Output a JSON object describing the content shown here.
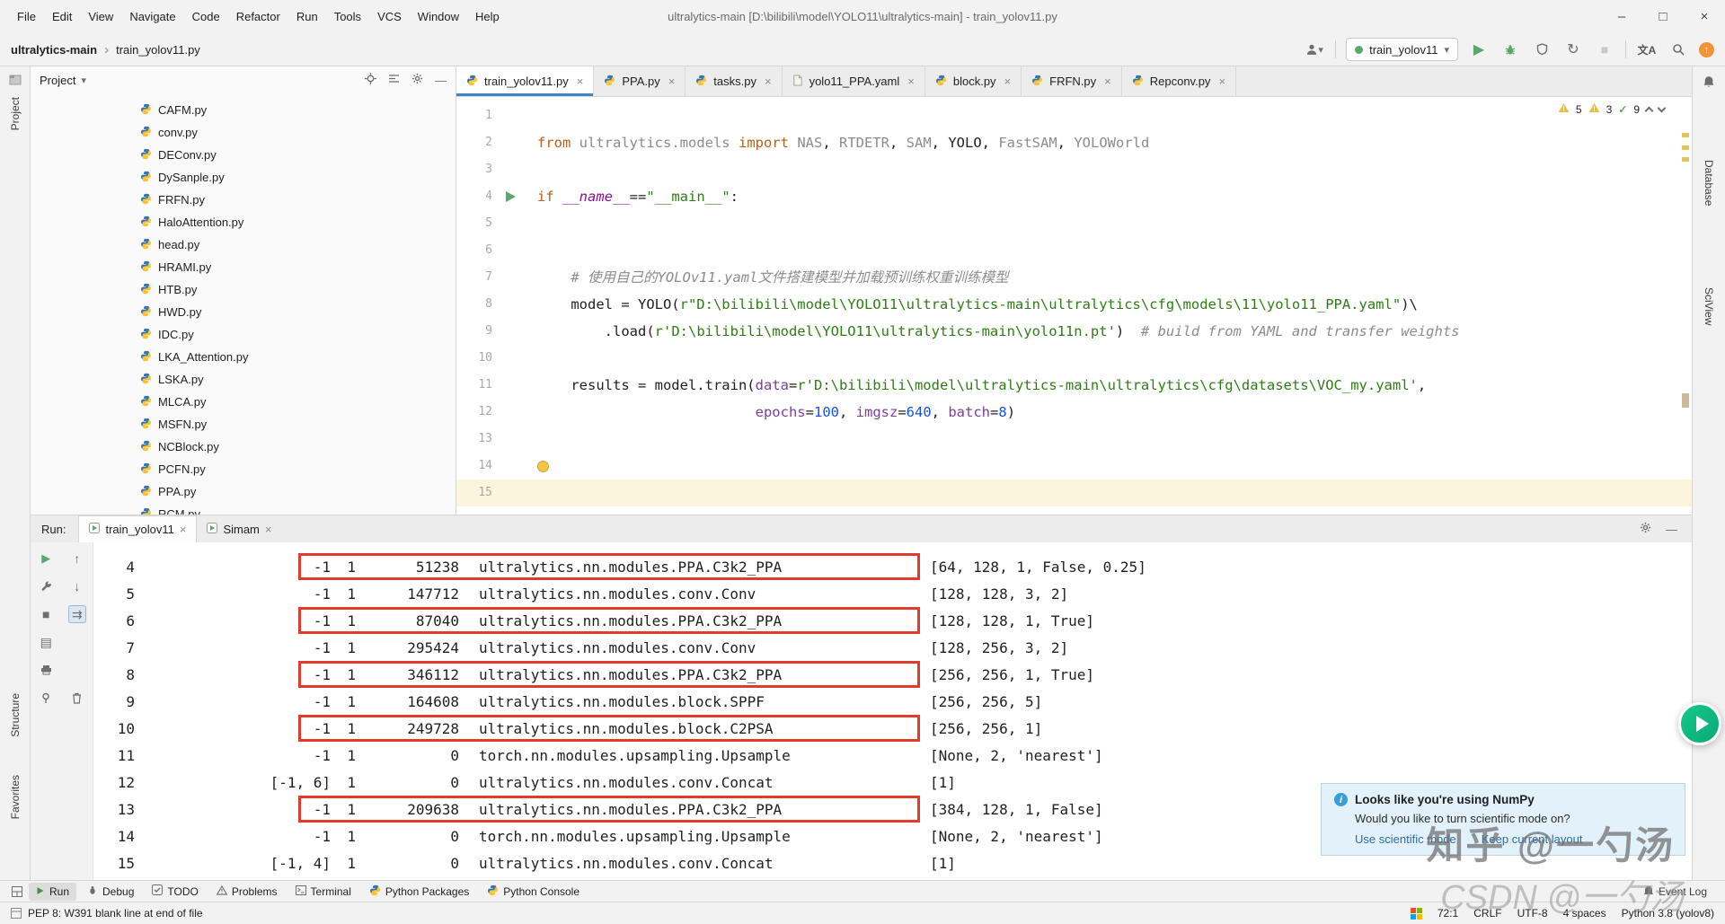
{
  "window": {
    "menus": [
      "File",
      "Edit",
      "View",
      "Navigate",
      "Code",
      "Refactor",
      "Run",
      "Tools",
      "VCS",
      "Window",
      "Help"
    ],
    "title": "ultralytics-main [D:\\bilibili\\model\\YOLO11\\ultralytics-main] - train_yolov11.py",
    "minimize": "–",
    "maximize": "□",
    "close": "×"
  },
  "breadcrumbs": {
    "project": "ultralytics-main",
    "separator": "›",
    "file": "train_yolov11.py"
  },
  "run_widget": {
    "config": "train_yolov11"
  },
  "strips": {
    "project": "Project",
    "structure": "Structure",
    "favorites": "Favorites",
    "database": "Database",
    "sciview": "SciView"
  },
  "project_panel": {
    "title": "Project",
    "files": [
      "CAFM.py",
      "conv.py",
      "DEConv.py",
      "DySanple.py",
      "FRFN.py",
      "HaloAttention.py",
      "head.py",
      "HRAMI.py",
      "HTB.py",
      "HWD.py",
      "IDC.py",
      "LKA_Attention.py",
      "LSKA.py",
      "MLCA.py",
      "MSFN.py",
      "NCBlock.py",
      "PCFN.py",
      "PPA.py",
      "RCM.py"
    ]
  },
  "editor": {
    "tabs": [
      {
        "label": "train_yolov11.py",
        "type": "py",
        "selected": true
      },
      {
        "label": "PPA.py",
        "type": "py",
        "selected": false
      },
      {
        "label": "tasks.py",
        "type": "py",
        "selected": false
      },
      {
        "label": "yolo11_PPA.yaml",
        "type": "yaml",
        "selected": false
      },
      {
        "label": "block.py",
        "type": "py",
        "selected": false
      },
      {
        "label": "FRFN.py",
        "type": "py",
        "selected": false
      },
      {
        "label": "Repconv.py",
        "type": "py",
        "selected": false
      }
    ],
    "inspections": {
      "warnings": "5",
      "weak_warnings": "3",
      "ok": "9"
    },
    "lines": [
      {
        "n": 1,
        "segs": []
      },
      {
        "n": 2,
        "segs": [
          {
            "t": "from ",
            "c": "kw"
          },
          {
            "t": "ultralytics.models ",
            "c": "gray"
          },
          {
            "t": "import ",
            "c": "kw"
          },
          {
            "t": "NAS",
            "c": "gray"
          },
          {
            "t": ", ",
            "c": "plain"
          },
          {
            "t": "RTDETR",
            "c": "gray"
          },
          {
            "t": ", ",
            "c": "plain"
          },
          {
            "t": "SAM",
            "c": "gray"
          },
          {
            "t": ", ",
            "c": "plain"
          },
          {
            "t": "YOLO",
            "c": "plain"
          },
          {
            "t": ", ",
            "c": "plain"
          },
          {
            "t": "FastSAM",
            "c": "gray"
          },
          {
            "t": ", ",
            "c": "plain"
          },
          {
            "t": "YOLOWorld",
            "c": "gray"
          }
        ]
      },
      {
        "n": 3,
        "segs": []
      },
      {
        "n": 4,
        "run_marker": true,
        "segs": [
          {
            "t": "if ",
            "c": "kw"
          },
          {
            "t": "__name__",
            "c": "special"
          },
          {
            "t": "==",
            "c": "plain"
          },
          {
            "t": "\"__main__\"",
            "c": "str"
          },
          {
            "t": ":",
            "c": "plain"
          }
        ]
      },
      {
        "n": 5,
        "segs": []
      },
      {
        "n": 6,
        "segs": []
      },
      {
        "n": 7,
        "segs": [
          {
            "t": "    # 使用自己的YOLOv11.yaml文件搭建模型并加载预训练权重训练模型",
            "c": "com"
          }
        ]
      },
      {
        "n": 8,
        "segs": [
          {
            "t": "    model = YOLO(",
            "c": "plain"
          },
          {
            "t": "r\"D:\\bilibili\\model\\YOLO11\\ultralytics-main\\ultralytics\\cfg\\models\\11\\yolo11_PPA.yaml\"",
            "c": "str"
          },
          {
            "t": ")\\",
            "c": "plain"
          }
        ]
      },
      {
        "n": 9,
        "segs": [
          {
            "t": "        .load(",
            "c": "plain"
          },
          {
            "t": "r'D:\\bilibili\\model\\YOLO11\\ultralytics-main\\yolo11n.pt'",
            "c": "str"
          },
          {
            "t": ")  ",
            "c": "plain"
          },
          {
            "t": "# build from YAML and transfer weights",
            "c": "com"
          }
        ]
      },
      {
        "n": 10,
        "segs": []
      },
      {
        "n": 11,
        "segs": [
          {
            "t": "    results = model.train(",
            "c": "plain"
          },
          {
            "t": "data",
            "c": "param"
          },
          {
            "t": "=",
            "c": "plain"
          },
          {
            "t": "r'D:\\bilibili\\model\\ultralytics-main\\ultralytics\\cfg\\datasets\\VOC_my.yaml'",
            "c": "str"
          },
          {
            "t": ",",
            "c": "plain"
          }
        ]
      },
      {
        "n": 12,
        "segs": [
          {
            "t": "                          ",
            "c": "plain"
          },
          {
            "t": "epochs",
            "c": "param"
          },
          {
            "t": "=",
            "c": "plain"
          },
          {
            "t": "100",
            "c": "num"
          },
          {
            "t": ", ",
            "c": "plain"
          },
          {
            "t": "imgsz",
            "c": "param"
          },
          {
            "t": "=",
            "c": "plain"
          },
          {
            "t": "640",
            "c": "num"
          },
          {
            "t": ", ",
            "c": "plain"
          },
          {
            "t": "batch",
            "c": "param"
          },
          {
            "t": "=",
            "c": "plain"
          },
          {
            "t": "8",
            "c": "num"
          },
          {
            "t": ")",
            "c": "plain"
          }
        ]
      },
      {
        "n": 13,
        "segs": []
      },
      {
        "n": 14,
        "bulb": true,
        "segs": []
      },
      {
        "n": 15,
        "caret": true,
        "segs": []
      }
    ]
  },
  "run_panel": {
    "label": "Run:",
    "tabs": [
      {
        "label": "train_yolov11",
        "selected": true
      },
      {
        "label": "Simam",
        "selected": false
      }
    ],
    "rows": [
      {
        "idx": "4",
        "from": "-1",
        "n": "1",
        "params": "51238",
        "module": "ultralytics.nn.modules.PPA.C3k2_PPA",
        "args": "[64, 128, 1, False, 0.25]",
        "highlighted": true
      },
      {
        "idx": "5",
        "from": "-1",
        "n": "1",
        "params": "147712",
        "module": "ultralytics.nn.modules.conv.Conv",
        "args": "[128, 128, 3, 2]",
        "highlighted": false
      },
      {
        "idx": "6",
        "from": "-1",
        "n": "1",
        "params": "87040",
        "module": "ultralytics.nn.modules.PPA.C3k2_PPA",
        "args": "[128, 128, 1, True]",
        "highlighted": true
      },
      {
        "idx": "7",
        "from": "-1",
        "n": "1",
        "params": "295424",
        "module": "ultralytics.nn.modules.conv.Conv",
        "args": "[128, 256, 3, 2]",
        "highlighted": false
      },
      {
        "idx": "8",
        "from": "-1",
        "n": "1",
        "params": "346112",
        "module": "ultralytics.nn.modules.PPA.C3k2_PPA",
        "args": "[256, 256, 1, True]",
        "highlighted": true
      },
      {
        "idx": "9",
        "from": "-1",
        "n": "1",
        "params": "164608",
        "module": "ultralytics.nn.modules.block.SPPF",
        "args": "[256, 256, 5]",
        "highlighted": false
      },
      {
        "idx": "10",
        "from": "-1",
        "n": "1",
        "params": "249728",
        "module": "ultralytics.nn.modules.block.C2PSA",
        "args": "[256, 256, 1]",
        "highlighted": true
      },
      {
        "idx": "11",
        "from": "-1",
        "n": "1",
        "params": "0",
        "module": "torch.nn.modules.upsampling.Upsample",
        "args": "[None, 2, 'nearest']",
        "highlighted": false
      },
      {
        "idx": "12",
        "from": "[-1, 6]",
        "n": "1",
        "params": "0",
        "module": "ultralytics.nn.modules.conv.Concat",
        "args": "[1]",
        "highlighted": false
      },
      {
        "idx": "13",
        "from": "-1",
        "n": "1",
        "params": "209638",
        "module": "ultralytics.nn.modules.PPA.C3k2_PPA",
        "args": "[384, 128, 1, False]",
        "highlighted": true
      },
      {
        "idx": "14",
        "from": "-1",
        "n": "1",
        "params": "0",
        "module": "torch.nn.modules.upsampling.Upsample",
        "args": "[None, 2, 'nearest']",
        "highlighted": false
      },
      {
        "idx": "15",
        "from": "[-1, 4]",
        "n": "1",
        "params": "0",
        "module": "ultralytics.nn.modules.conv.Concat",
        "args": "[1]",
        "highlighted": false
      }
    ]
  },
  "notification": {
    "title": "Looks like you're using NumPy",
    "body": "Would you like to turn scientific mode on?",
    "link1": "Use scientific mode",
    "link2": "Keep current layout"
  },
  "bottom_bar": {
    "items": [
      {
        "label": "Run",
        "icon": "run",
        "active": true
      },
      {
        "label": "Debug",
        "icon": "debug",
        "active": false
      },
      {
        "label": "TODO",
        "icon": "todo",
        "active": false
      },
      {
        "label": "Problems",
        "icon": "problems",
        "active": false
      },
      {
        "label": "Terminal",
        "icon": "terminal",
        "active": false
      },
      {
        "label": "Python Packages",
        "icon": "python",
        "active": false
      },
      {
        "label": "Python Console",
        "icon": "python",
        "active": false
      }
    ],
    "event_log": "Event Log"
  },
  "status_bar": {
    "message": "PEP 8: W391 blank line at end of file",
    "caret": "72:1",
    "line_sep": "CRLF",
    "encoding": "UTF-8",
    "indent": "4 spaces",
    "interpreter": "Python 3.8 (yolov8)"
  },
  "watermarks": {
    "zhihu": "知乎 @一勺汤",
    "csdn": "CSDN @一勺汤"
  }
}
